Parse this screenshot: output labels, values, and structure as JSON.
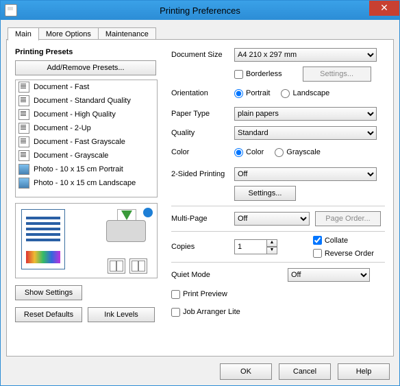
{
  "window": {
    "title": "Printing Preferences"
  },
  "tabs": {
    "main": "Main",
    "more": "More Options",
    "maint": "Maintenance"
  },
  "presets": {
    "heading": "Printing Presets",
    "add_remove": "Add/Remove Presets...",
    "items": [
      "Document - Fast",
      "Document - Standard Quality",
      "Document - High Quality",
      "Document - 2-Up",
      "Document - Fast Grayscale",
      "Document - Grayscale",
      "Photo - 10 x 15 cm Portrait",
      "Photo - 10 x 15 cm Landscape"
    ]
  },
  "left_buttons": {
    "show_settings": "Show Settings",
    "reset_defaults": "Reset Defaults",
    "ink_levels": "Ink Levels"
  },
  "labels": {
    "doc_size": "Document Size",
    "orientation": "Orientation",
    "paper_type": "Paper Type",
    "quality": "Quality",
    "color": "Color",
    "two_sided": "2-Sided Printing",
    "multi_page": "Multi-Page",
    "copies": "Copies",
    "quiet_mode": "Quiet Mode"
  },
  "values": {
    "doc_size": "A4 210 x 297 mm",
    "borderless": "Borderless",
    "settings": "Settings...",
    "portrait": "Portrait",
    "landscape": "Landscape",
    "paper_type": "plain papers",
    "quality": "Standard",
    "color": "Color",
    "grayscale": "Grayscale",
    "two_sided": "Off",
    "two_sided_settings": "Settings...",
    "multi_page": "Off",
    "page_order": "Page Order...",
    "copies": "1",
    "collate": "Collate",
    "reverse": "Reverse Order",
    "quiet_mode": "Off",
    "print_preview": "Print Preview",
    "job_arranger": "Job Arranger Lite"
  },
  "footer": {
    "ok": "OK",
    "cancel": "Cancel",
    "help": "Help"
  }
}
